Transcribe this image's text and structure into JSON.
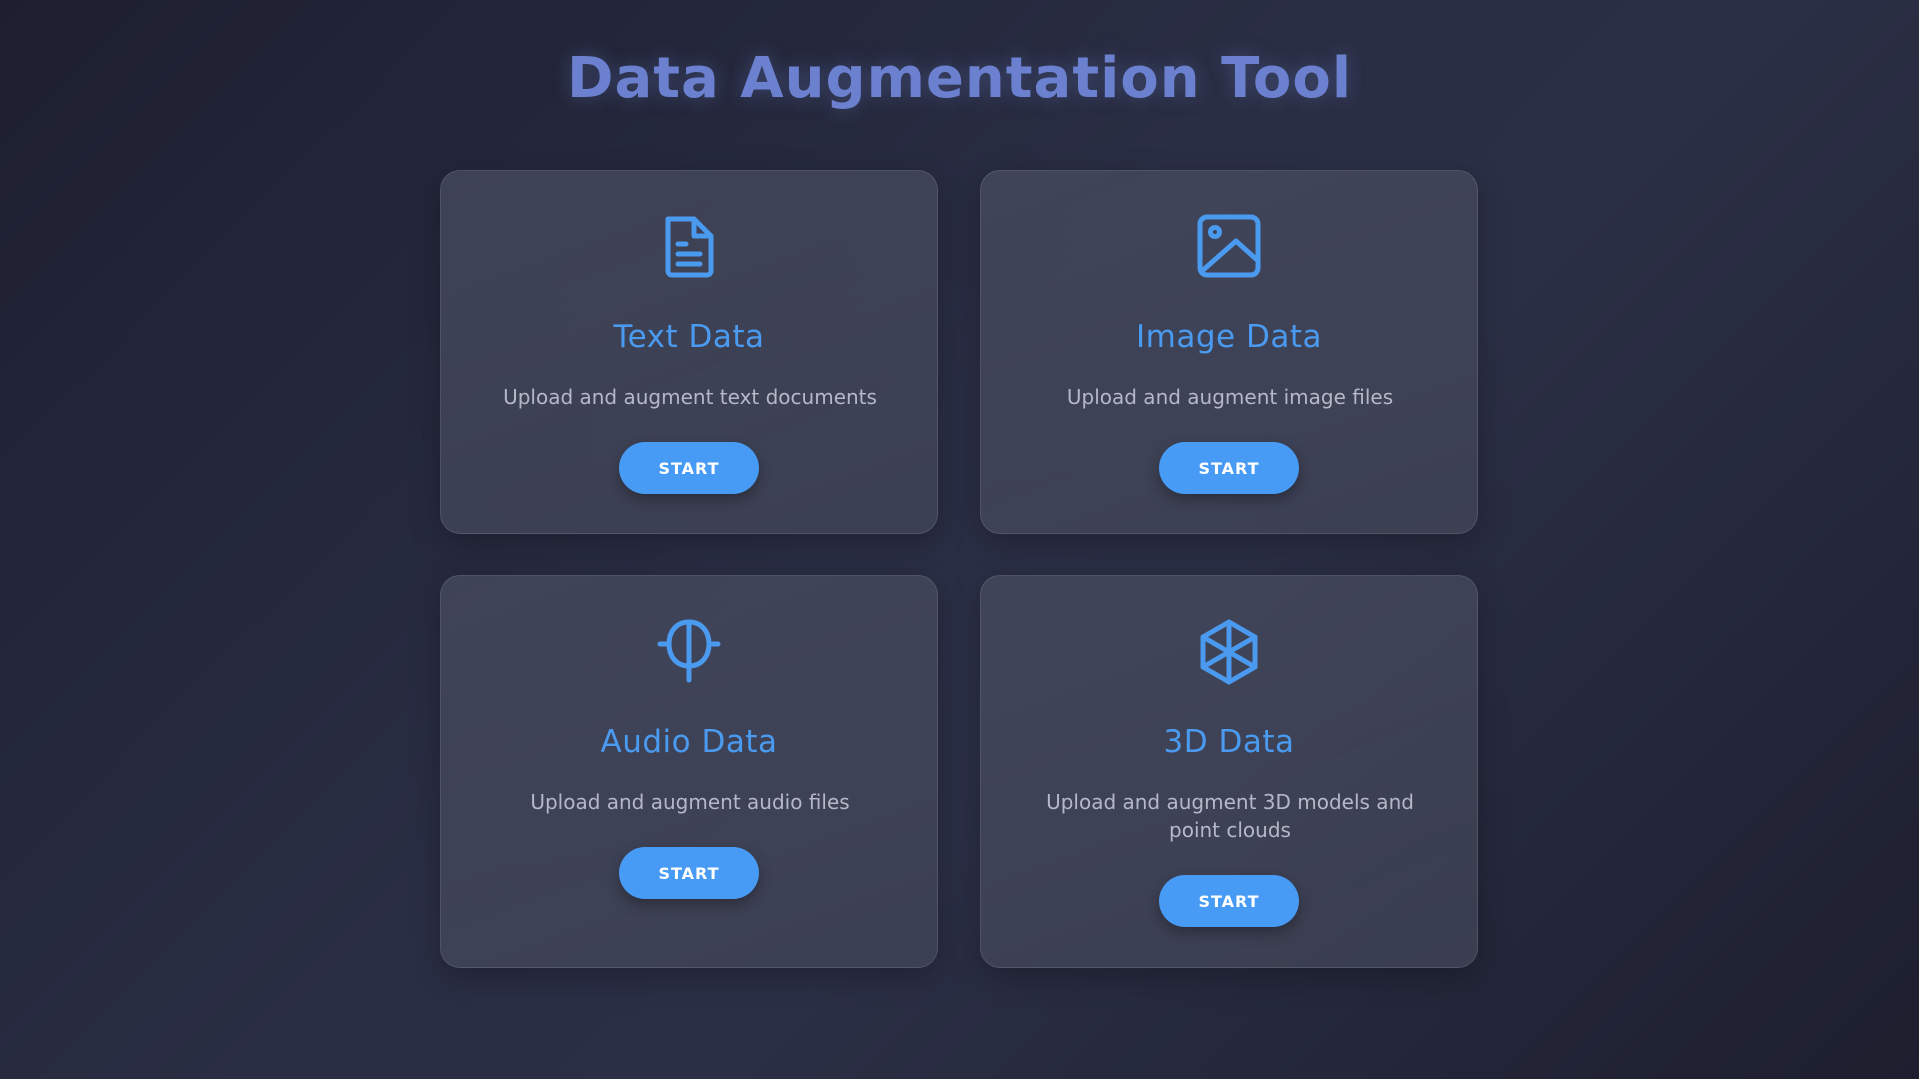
{
  "page": {
    "title": "Data Augmentation Tool"
  },
  "colors": {
    "title": "#6b80cf",
    "accent": "#4a9af0",
    "button": "#479bf4",
    "background": "#23263a",
    "card": "#444860"
  },
  "cards": [
    {
      "icon": "document-icon",
      "title": "Text Data",
      "description": "Upload and augment text documents",
      "button_label": "START"
    },
    {
      "icon": "image-icon",
      "title": "Image Data",
      "description": "Upload and augment image files",
      "button_label": "START"
    },
    {
      "icon": "audio-icon",
      "title": "Audio Data",
      "description": "Upload and augment audio files",
      "button_label": "START"
    },
    {
      "icon": "cube-icon",
      "title": "3D Data",
      "description": "Upload and augment 3D models and point clouds",
      "button_label": "START"
    }
  ]
}
